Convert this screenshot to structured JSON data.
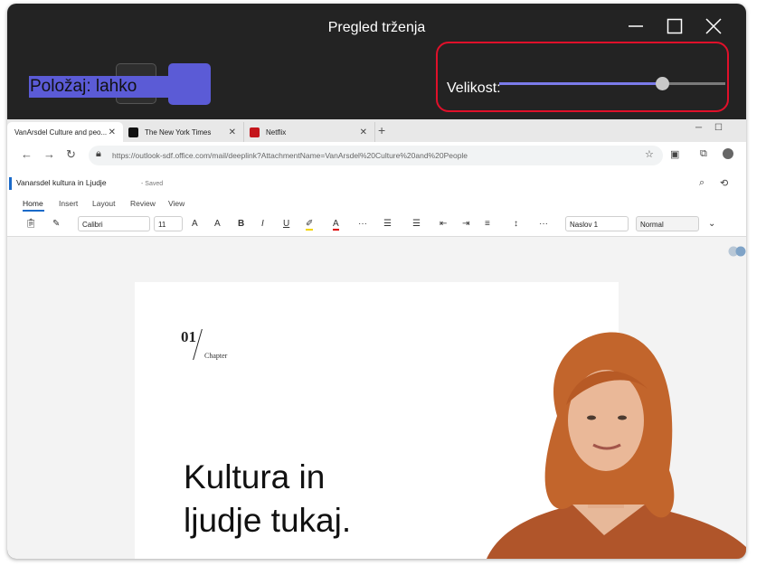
{
  "window": {
    "title": "Pregled trženja"
  },
  "position": {
    "label": "Položaj: lahko"
  },
  "size": {
    "label": "Velikost:",
    "value": 0.72
  },
  "browser": {
    "tabs": [
      {
        "label": "VanArsdel Culture and peo..."
      },
      {
        "label": "The New York Times"
      },
      {
        "label": "Netflix"
      }
    ],
    "url": "https://outlook-sdf.office.com/mail/deeplink?AttachmentName=VanArsdel%20Culture%20and%20People"
  },
  "word": {
    "doc_title": "Vanarsdel kultura in Ljudje",
    "saved": "- Saved",
    "ribbon_tabs": [
      "Home",
      "Insert",
      "Layout",
      "Review",
      "View"
    ],
    "font": "Calibri",
    "font_size": "11",
    "style_1": "Naslov 1",
    "style_2": "Normal"
  },
  "document": {
    "chapter_number": "01",
    "chapter_label": "Chapter",
    "headline_line1": "Kultura in",
    "headline_line2": "ljudje tukaj."
  },
  "colors": {
    "accent": "#5b5bd6",
    "highlight": "#e0102a",
    "background": "#232323"
  },
  "icons": [
    "minimize-icon",
    "maximize-icon",
    "close-icon",
    "back-icon",
    "forward-icon",
    "refresh-icon",
    "lock-icon",
    "search-icon",
    "history-icon"
  ]
}
